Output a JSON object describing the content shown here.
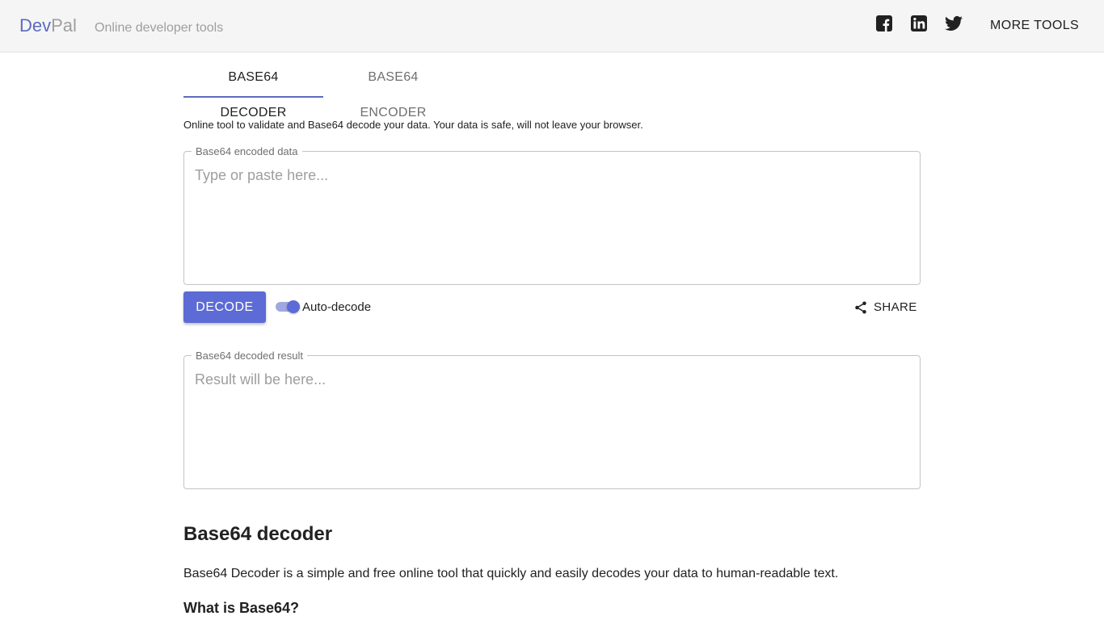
{
  "header": {
    "logo_part1": "Dev",
    "logo_part2": "Pal",
    "tagline": "Online developer tools",
    "social": [
      "facebook-icon",
      "linkedin-icon",
      "twitter-icon"
    ],
    "more_tools_label": "MORE TOOLS"
  },
  "tabs": [
    {
      "label": "BASE64 DECODER",
      "active": true
    },
    {
      "label": "BASE64 ENCODER",
      "active": false
    }
  ],
  "intro": "Online tool to validate and Base64 decode your data. Your data is safe, will not leave your browser.",
  "input": {
    "label": "Base64 encoded data",
    "placeholder": "Type or paste here...",
    "value": ""
  },
  "actions": {
    "decode_label": "DECODE",
    "auto_decode_label": "Auto-decode",
    "auto_decode_on": true,
    "share_label": "SHARE"
  },
  "output": {
    "label": "Base64 decoded result",
    "placeholder": "Result will be here...",
    "value": ""
  },
  "content": {
    "heading": "Base64 decoder",
    "paragraph": "Base64 Decoder is a simple and free online tool that quickly and easily decodes your data to human-readable text.",
    "subheading": "What is Base64?"
  },
  "colors": {
    "accent": "#5c6bd6",
    "appbar_bg": "#f5f5f5"
  }
}
